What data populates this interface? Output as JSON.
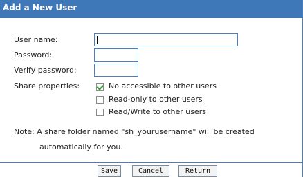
{
  "form": {
    "title": "Add a New User",
    "fields": {
      "username_label": "User name:",
      "password_label": "Password:",
      "verify_label": "Verify password:",
      "share_label": "Share properties:"
    },
    "share_options": [
      {
        "label": "No accessible to other users",
        "checked": true
      },
      {
        "label": "Read-only to other users",
        "checked": false
      },
      {
        "label": "Read/Write to other users",
        "checked": false
      }
    ],
    "note_line1": "Note: A share folder named \"sh_yourusername\" will be created",
    "note_line2": "automatically for you."
  },
  "buttons": {
    "save": "Save",
    "cancel": "Cancel",
    "return": "Return"
  }
}
